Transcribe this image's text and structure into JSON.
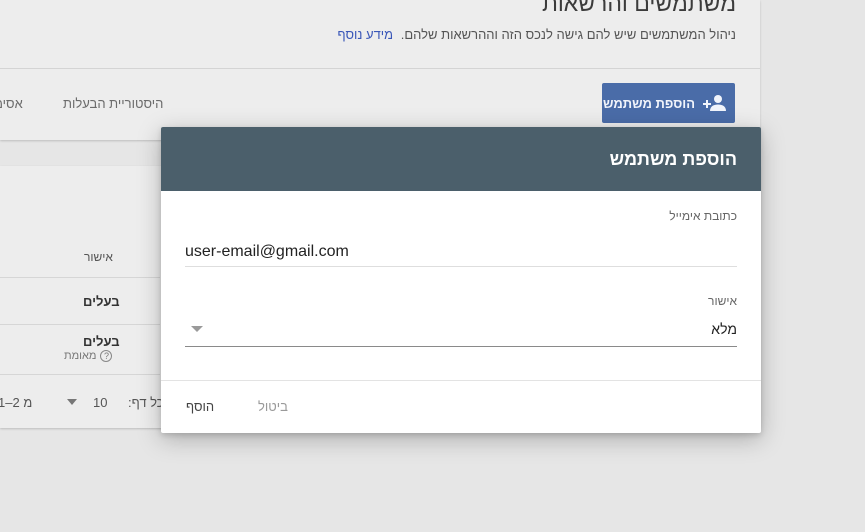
{
  "page": {
    "title": "משתמשים והרשאות",
    "description": "ניהול המשתמשים שיש להם גישה לנכס הזה וההרשאות שלהם.",
    "more_info_link": "מידע נוסף",
    "add_user_button": "הוספת משתמש",
    "tabs": [
      "היסטוריית הבעלות",
      "אסימ"
    ],
    "table": {
      "column_header": "אישור",
      "rows": [
        {
          "permission": "בעלים"
        },
        {
          "permission": "בעלים",
          "status": "מאומת"
        }
      ],
      "pagination": {
        "rows_per_page_label": "כל דף:",
        "rows_per_page_value": "10",
        "range": "1–2 מ"
      }
    }
  },
  "dialog": {
    "title": "הוספת משתמש",
    "email_label": "כתובת אימייל",
    "email_value": "user-email@gmail.com",
    "permission_label": "אישור",
    "permission_value": "מלא",
    "cancel_button": "ביטול",
    "add_button": "הוסף"
  },
  "colors": {
    "dialog_header": "#4b5f6b",
    "primary_button": "#4a6ca8",
    "link": "#3a57b8",
    "overlay_background": "#e6e6e6"
  }
}
